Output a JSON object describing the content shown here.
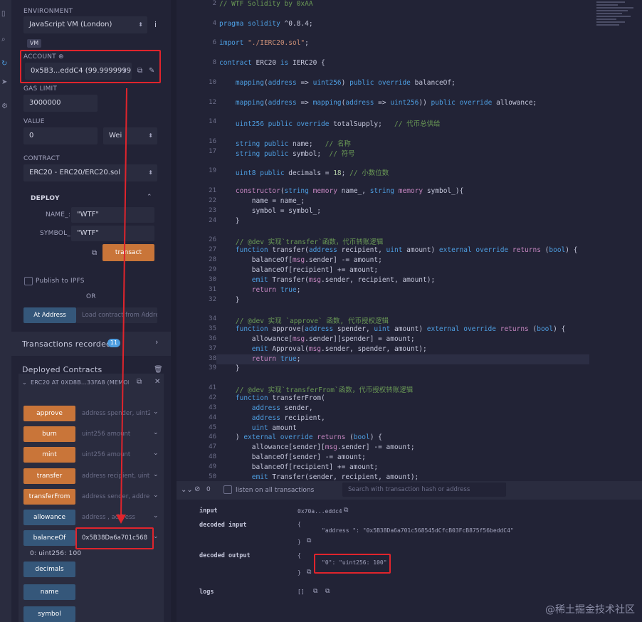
{
  "deploy_panel": {
    "environment_label": "ENVIRONMENT",
    "environment_value": "JavaScript VM (London)",
    "vm_badge": "VM",
    "account_label": "ACCOUNT",
    "account_value": "0x5B3...eddC4 (99.9999999",
    "gas_limit_label": "GAS LIMIT",
    "gas_limit_value": "3000000",
    "value_label": "VALUE",
    "value_amount": "0",
    "value_unit": "Wei",
    "contract_label": "CONTRACT",
    "contract_value": "ERC20 - ERC20/ERC20.sol",
    "deploy_label": "DEPLOY",
    "name_param_label": "NAME_:",
    "name_param_value": "\"WTF\"",
    "symbol_param_label": "SYMBOL_:",
    "symbol_param_value": "\"WTF\"",
    "transact_label": "transact",
    "publish_label": "Publish to IPFS",
    "or_label": "OR",
    "at_address_label": "At Address",
    "load_contract_placeholder": "Load contract from Addre",
    "transactions_label": "Transactions recorded",
    "transactions_count": "11",
    "deployed_label": "Deployed Contracts",
    "instance_label": "ERC20 AT 0XD8B...33FA8 (MEMOF"
  },
  "functions": [
    {
      "name": "approve",
      "placeholder": "address spender, uint2"
    },
    {
      "name": "burn",
      "placeholder": "uint256 amount"
    },
    {
      "name": "mint",
      "placeholder": "uint256 amount"
    },
    {
      "name": "transfer",
      "placeholder": "address recipient, uint"
    },
    {
      "name": "transferFrom",
      "placeholder": "address sender, addre"
    },
    {
      "name": "allowance",
      "placeholder": "address , address"
    },
    {
      "name": "balanceOf",
      "placeholder": "0x5B38Da6a701c568"
    },
    {
      "name": "decimals"
    },
    {
      "name": "name"
    },
    {
      "name": "symbol"
    }
  ],
  "balance_result": "0: uint256: 100",
  "editor": {
    "lines": [
      {
        "num": "2",
        "html": "<span class='c'>// WTF Solidity by 0xAA</span>"
      },
      {
        "num": "4",
        "html": "<span class='k'>pragma solidity</span> ^0.8.4;"
      },
      {
        "num": "6",
        "html": "<span class='k'>import</span> <span class='s'>\"./IERC20.sol\"</span>;"
      },
      {
        "num": "8",
        "html": "<span class='k'>contract</span> ERC20 <span class='k'>is</span> IERC20 {"
      },
      {
        "num": "10",
        "html": "    <span class='k'>mapping</span>(<span class='t'>address</span> => <span class='t'>uint256</span>) <span class='k'>public override</span> balanceOf;"
      },
      {
        "num": "12",
        "html": "    <span class='k'>mapping</span>(<span class='t'>address</span> => <span class='k'>mapping</span>(<span class='t'>address</span> => <span class='t'>uint256</span>)) <span class='k'>public override</span> allowance;"
      },
      {
        "num": "14",
        "html": "    <span class='t'>uint256</span> <span class='k'>public override</span> totalSupply;   <span class='c'>// 代币总供给</span>"
      },
      {
        "num": "16",
        "html": "    <span class='t'>string</span> <span class='k'>public</span> name;   <span class='c'>// 名称</span>"
      },
      {
        "num": "17",
        "html": "    <span class='t'>string</span> <span class='k'>public</span> symbol;  <span class='c'>// 符号</span>"
      },
      {
        "num": "19",
        "html": "    <span class='t'>uint8</span> <span class='k'>public</span> decimals = <span class='n'>18</span>; <span class='c'>// 小数位数</span>"
      },
      {
        "num": "21",
        "html": "    <span class='m'>constructor</span>(<span class='t'>string</span> <span class='m'>memory</span> name_, <span class='t'>string</span> <span class='m'>memory</span> symbol_){"
      },
      {
        "num": "22",
        "html": "        name = name_;"
      },
      {
        "num": "23",
        "html": "        symbol = symbol_;"
      },
      {
        "num": "24",
        "html": "    }"
      },
      {
        "num": "26",
        "html": "    <span class='c'>// @dev 实现`transfer`函数，代币转账逻辑</span>"
      },
      {
        "num": "27",
        "html": "    <span class='k'>function</span> transfer(<span class='t'>address</span> recipient, <span class='t'>uint</span> amount) <span class='k'>external override</span> <span class='m'>returns</span> (<span class='t'>bool</span>) {"
      },
      {
        "num": "28",
        "html": "        balanceOf[<span class='m'>msg</span>.sender] -= amount;"
      },
      {
        "num": "29",
        "html": "        balanceOf[recipient] += amount;"
      },
      {
        "num": "30",
        "html": "        <span class='k'>emit</span> Transfer(<span class='m'>msg</span>.sender, recipient, amount);"
      },
      {
        "num": "31",
        "html": "        <span class='m'>return</span> <span class='k'>true</span>;"
      },
      {
        "num": "32",
        "html": "    }"
      },
      {
        "num": "34",
        "html": "    <span class='c'>// @dev 实现 `approve` 函数, 代币授权逻辑</span>"
      },
      {
        "num": "35",
        "html": "    <span class='k'>function</span> approve(<span class='t'>address</span> spender, <span class='t'>uint</span> amount) <span class='k'>external override</span> <span class='m'>returns</span> (<span class='t'>bool</span>) {"
      },
      {
        "num": "36",
        "html": "        allowance[<span class='m'>msg</span>.sender][spender] = amount;"
      },
      {
        "num": "37",
        "html": "        <span class='k'>emit</span> Approval(<span class='m'>msg</span>.sender, spender, amount);"
      },
      {
        "num": "38",
        "html": "        <span class='m'>return</span> <span class='k'>true</span>;"
      },
      {
        "num": "39",
        "html": "    }"
      },
      {
        "num": "41",
        "html": "    <span class='c'>// @dev 实现`transferFrom`函数，代币授权转账逻辑</span>"
      },
      {
        "num": "42",
        "html": "    <span class='k'>function</span> transferFrom("
      },
      {
        "num": "43",
        "html": "        <span class='t'>address</span> sender,"
      },
      {
        "num": "44",
        "html": "        <span class='t'>address</span> recipient,"
      },
      {
        "num": "45",
        "html": "        <span class='t'>uint</span> amount"
      },
      {
        "num": "46",
        "html": "    ) <span class='k'>external override</span> <span class='m'>returns</span> (<span class='t'>bool</span>) {"
      },
      {
        "num": "47",
        "html": "        allowance[sender][<span class='m'>msg</span>.sender] -= amount;"
      },
      {
        "num": "48",
        "html": "        balanceOf[sender] -= amount;"
      },
      {
        "num": "49",
        "html": "        balanceOf[recipient] += amount;"
      },
      {
        "num": "50",
        "html": "        <span class='k'>emit</span> Transfer(sender, recipient, amount);"
      }
    ]
  },
  "terminal": {
    "pending_count": "0",
    "listen_label": "listen on all transactions",
    "search_placeholder": "Search with transaction hash or address",
    "input_label": "input",
    "input_value": "0x70a...eddc4",
    "decoded_input_label": "decoded input",
    "open_brace": "{",
    "close_brace": "}",
    "decoded_input_value": "\"address \": \"0x5B38Da6a701c568545dCfcB03FcB875f56beddC4\"",
    "decoded_output_label": "decoded output",
    "decoded_output_value": "\"0\": \"uint256: 100\"",
    "logs_label": "logs",
    "logs_value": "[]"
  },
  "watermark": "@稀土掘金技术社区"
}
